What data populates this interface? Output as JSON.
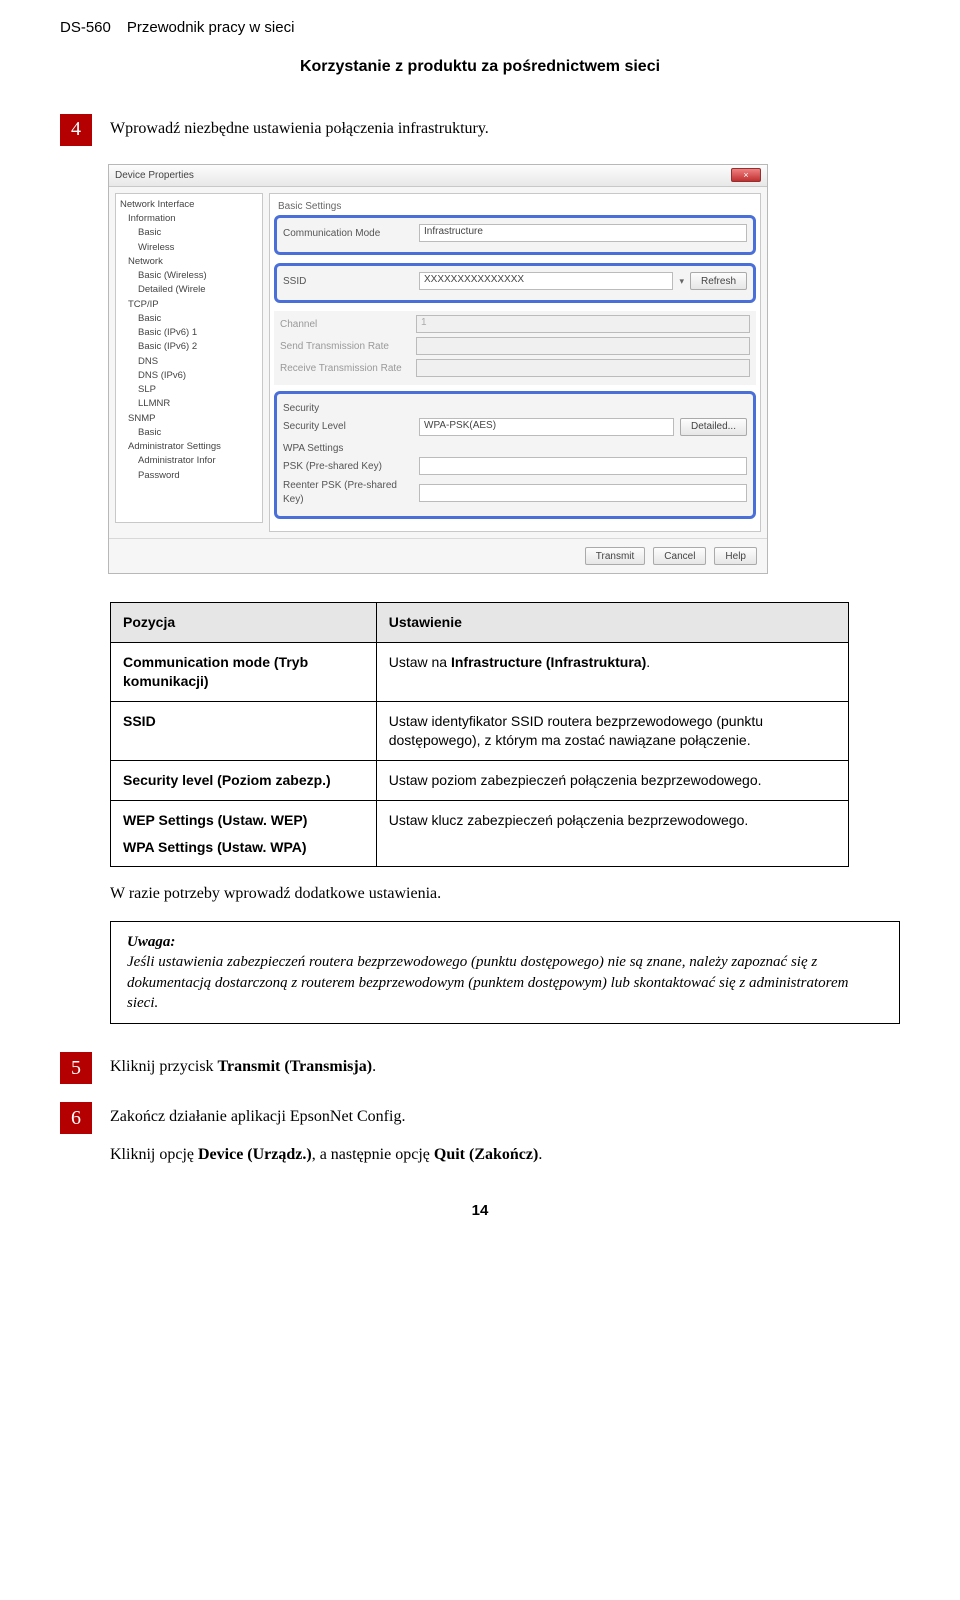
{
  "header": {
    "model": "DS-560",
    "guide_title": "Przewodnik pracy w sieci"
  },
  "section_heading": "Korzystanie z produktu za pośrednictwem sieci",
  "step4": {
    "num": "4",
    "text": "Wprowadź niezbędne ustawienia połączenia infrastruktury."
  },
  "dialog": {
    "title": "Device Properties",
    "close": "×",
    "tree": {
      "root": "Network Interface",
      "items": [
        {
          "lvl": 1,
          "t": "Information"
        },
        {
          "lvl": 2,
          "t": "Basic"
        },
        {
          "lvl": 2,
          "t": "Wireless"
        },
        {
          "lvl": 1,
          "t": "Network"
        },
        {
          "lvl": 2,
          "t": "Basic (Wireless)"
        },
        {
          "lvl": 2,
          "t": "Detailed (Wirele"
        },
        {
          "lvl": 1,
          "t": "TCP/IP"
        },
        {
          "lvl": 2,
          "t": "Basic"
        },
        {
          "lvl": 2,
          "t": "Basic (IPv6) 1"
        },
        {
          "lvl": 2,
          "t": "Basic (IPv6) 2"
        },
        {
          "lvl": 2,
          "t": "DNS"
        },
        {
          "lvl": 2,
          "t": "DNS (IPv6)"
        },
        {
          "lvl": 2,
          "t": "SLP"
        },
        {
          "lvl": 2,
          "t": "LLMNR"
        },
        {
          "lvl": 1,
          "t": "SNMP"
        },
        {
          "lvl": 2,
          "t": "Basic"
        },
        {
          "lvl": 1,
          "t": "Administrator Settings"
        },
        {
          "lvl": 2,
          "t": "Administrator Infor"
        },
        {
          "lvl": 2,
          "t": "Password"
        }
      ]
    },
    "panel_head": "Basic Settings",
    "comm_mode_label": "Communication Mode",
    "comm_mode_value": "Infrastructure",
    "ssid_label": "SSID",
    "ssid_value": "XXXXXXXXXXXXXXX",
    "refresh": "Refresh",
    "channel_label": "Channel",
    "channel_value": "1",
    "stx_label": "Send Transmission Rate",
    "rtx_label": "Receive Transmission Rate",
    "sec_title": "Security",
    "sec_level_label": "Security Level",
    "sec_level_value": "WPA-PSK(AES)",
    "detailed_btn": "Detailed...",
    "wpa_title": "WPA Settings",
    "psk_label": "PSK (Pre-shared Key)",
    "re_psk_label": "Reenter PSK (Pre-shared Key)",
    "transmit": "Transmit",
    "cancel": "Cancel",
    "help": "Help"
  },
  "table": {
    "h1": "Pozycja",
    "h2": "Ustawienie",
    "rows": [
      {
        "l": "Communication mode (Tryb komunikacji)",
        "r_pre": "Ustaw na ",
        "r_b": "Infrastructure (Infrastruktura)",
        "r_post": "."
      },
      {
        "l": "SSID",
        "r": "Ustaw identyfikator SSID routera bezprzewodowego (punktu dostępowego), z którym ma zostać nawiązane połączenie."
      },
      {
        "l": "Security level (Poziom zabezp.)",
        "r": "Ustaw poziom zabezpieczeń połączenia bezprzewodowego."
      },
      {
        "l": "WEP Settings (Ustaw. WEP)",
        "l2": "WPA Settings (Ustaw. WPA)",
        "r": "Ustaw klucz zabezpieczeń połączenia bezprzewodowego."
      }
    ]
  },
  "extra_para": "W razie potrzeby wprowadź dodatkowe ustawienia.",
  "note": {
    "title": "Uwaga:",
    "body": "Jeśli ustawienia zabezpieczeń routera bezprzewodowego (punktu dostępowego) nie są znane, należy zapoznać się z dokumentacją dostarczoną z routerem bezprzewodowym (punktem dostępowym) lub skontaktować się z administratorem sieci."
  },
  "step5": {
    "num": "5",
    "pre": "Kliknij przycisk ",
    "b": "Transmit (Transmisja)",
    "post": "."
  },
  "step6": {
    "num": "6",
    "line1": "Zakończ działanie aplikacji EpsonNet Config.",
    "line2_pre": "Kliknij opcję ",
    "line2_b1": "Device (Urządz.)",
    "line2_mid": ", a następnie opcję ",
    "line2_b2": "Quit (Zakończ)",
    "line2_post": "."
  },
  "page_number": "14"
}
